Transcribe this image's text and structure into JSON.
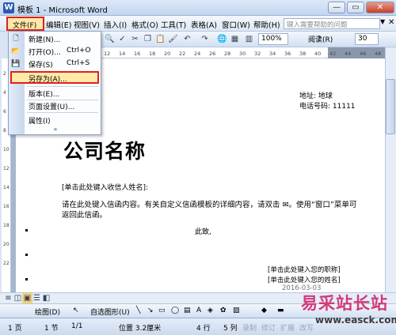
{
  "window": {
    "title": "模板 1 - Microsoft Word",
    "icon_label": "W",
    "minimize": "—",
    "maximize": "▭",
    "close": "✕"
  },
  "menubar": {
    "items": [
      "文件(F)",
      "编辑(E)",
      "视图(V)",
      "插入(I)",
      "格式(O)",
      "工具(T)",
      "表格(A)",
      "窗口(W)",
      "帮助(H)"
    ],
    "help_placeholder": "键入需要帮助的问题",
    "help_arrow": "▼",
    "help_close": "✕"
  },
  "toolbar": {
    "zoom": "100%",
    "read_label": "阅读(R)",
    "font_size": "30"
  },
  "ruler": {
    "numbers": [
      "12",
      "14",
      "16",
      "18",
      "20",
      "22",
      "24",
      "26",
      "28",
      "30",
      "32",
      "34",
      "36",
      "38",
      "40",
      "42",
      "44",
      "46",
      "48"
    ]
  },
  "vruler": {
    "numbers": [
      "2",
      "4",
      "6",
      "8",
      "10",
      "12",
      "14",
      "16",
      "18",
      "20",
      "22"
    ]
  },
  "file_menu": {
    "items": [
      {
        "label": "新建(N)...",
        "shortcut": ""
      },
      {
        "label": "打开(O)...",
        "shortcut": "Ctrl+O"
      },
      {
        "label": "保存(S)",
        "shortcut": "Ctrl+S"
      },
      {
        "label": "另存为(A)...",
        "shortcut": ""
      },
      {
        "label": "版本(E)...",
        "shortcut": ""
      },
      {
        "label": "页面设置(U)...",
        "shortcut": ""
      },
      {
        "label": "属性(I)",
        "shortcut": ""
      }
    ],
    "expand": "»"
  },
  "document": {
    "address": "地址: 地球",
    "phone": "电话号码: 11111",
    "company_name": "公司名称",
    "recipient": "[单击此处键入收信人姓名]: ",
    "body": "请在此处键入信函内容。有关自定义信函模板的详细内容，请双击 ✉。使用“窗口”菜单可返回此信函。",
    "closing": "此致,",
    "sign_title": "[单击此处键入您的职称]",
    "sign_name": "[单击此处键入您的姓名]",
    "sign_date": "2016-03-03"
  },
  "drawbar": {
    "draw_label": "绘图(D)",
    "autoshape_label": "自选图形(U)"
  },
  "statusbar": {
    "page": "1 页",
    "section": "1 节",
    "page_of": "1/1",
    "position": "位置 3.2厘米",
    "line": "4 行",
    "column": "5 列",
    "rec": "录制",
    "trk": "修订",
    "ext": "扩展",
    "ovr": "改写"
  },
  "watermark": {
    "title": "易采站长站",
    "url": "www.easck.com"
  },
  "colors": {
    "highlight_border": "#e02020",
    "highlight_fill": "#ffe9a8",
    "watermark": "#d23a7a"
  }
}
